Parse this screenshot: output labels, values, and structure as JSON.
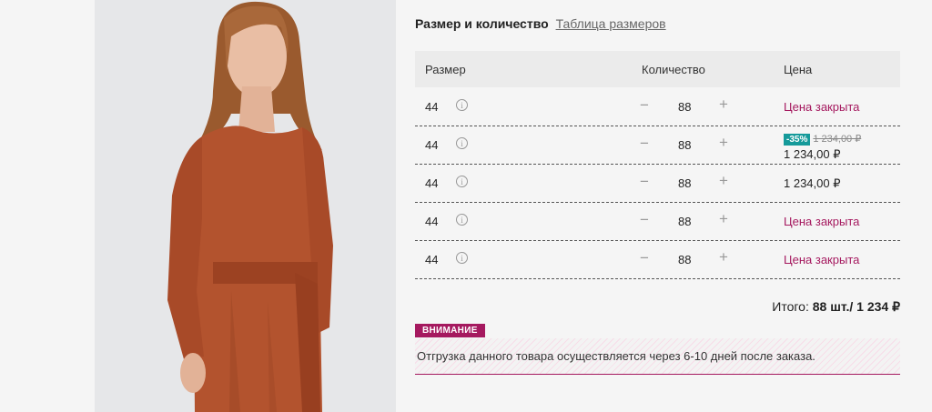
{
  "section": {
    "title": "Размер и количество",
    "size_chart_link": "Таблица размеров"
  },
  "table": {
    "headers": {
      "size": "Размер",
      "quantity": "Количество",
      "price": "Цена"
    },
    "rows": [
      {
        "size": "44",
        "quantity": "88",
        "price": "Цена закрыта"
      },
      {
        "size": "44",
        "quantity": "88",
        "discount": "-35%",
        "old_price": "1 234,00 ₽",
        "price": "1 234,00 ₽"
      },
      {
        "size": "44",
        "quantity": "88",
        "price": "1 234,00 ₽"
      },
      {
        "size": "44",
        "quantity": "88",
        "price": "Цена закрыта"
      },
      {
        "size": "44",
        "quantity": "88",
        "price": "Цена закрыта"
      }
    ],
    "info_glyph": "i",
    "minus_glyph": "−",
    "plus_glyph": "+"
  },
  "total": {
    "label": "Итого:",
    "value": "88 шт./ 1 234 ₽"
  },
  "notice": {
    "label": "ВНИМАНИЕ",
    "text": "Отгрузка данного товара осуществляется через 6-10 дней после заказа."
  },
  "colors": {
    "accent": "#a5195f",
    "discount_badge": "#159a9a",
    "header_bg": "#ebebeb",
    "page_bg": "#f5f5f5"
  },
  "icons": {
    "info": "info-circle-icon",
    "minus": "minus-icon",
    "plus": "plus-icon"
  }
}
